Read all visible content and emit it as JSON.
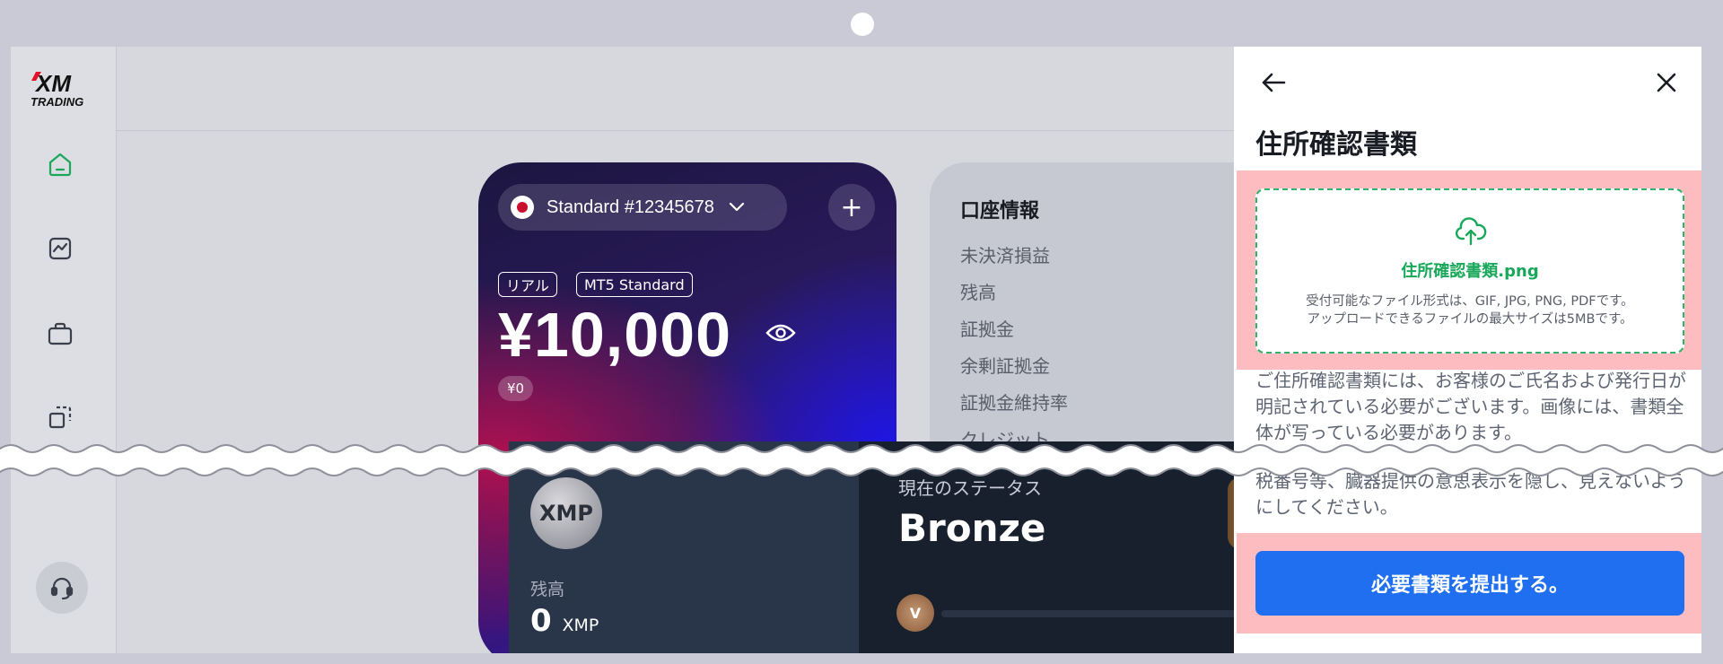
{
  "logo": {
    "brand": "XM",
    "sub": "TRADING"
  },
  "nav": {
    "items": [
      {
        "name": "home",
        "icon": "home-icon",
        "active": true
      },
      {
        "name": "chart",
        "icon": "chart-icon"
      },
      {
        "name": "portfolio",
        "icon": "briefcase-icon"
      },
      {
        "name": "copy",
        "icon": "copy-icon"
      }
    ],
    "support_icon": "headset-icon"
  },
  "account": {
    "selector": "Standard #12345678",
    "tags": [
      "リアル",
      "MT5 Standard"
    ],
    "balance": "¥10,000",
    "sub_balance": "¥0"
  },
  "info": {
    "title": "口座情報",
    "rows": [
      "未決済損益",
      "残高",
      "証拠金",
      "余剰証拠金",
      "証拠金維持率",
      "クレジット"
    ]
  },
  "xmp": {
    "coin_label": "XMP",
    "label": "残高",
    "value": "0",
    "unit": "XMP"
  },
  "status": {
    "label": "現在のステータス",
    "value": "Bronze",
    "badge": "V"
  },
  "modal": {
    "title": "住所確認書類",
    "file_name": "住所確認書類.png",
    "file_note_1": "受付可能なファイル形式は、GIF, JPG, PNG, PDFです。",
    "file_note_2": "アップロードできるファイルの最大サイズは5MBです。",
    "desc_1": "ご住所確認書類には、お客様のご氏名および発行日が明記されている必要がございます。画像には、書類全体が写っている必要があります。",
    "desc_2": "税番号等、臓器提供の意思表示を隠し、見えないようにしてください。",
    "submit": "必要書類を提出する。"
  },
  "colors": {
    "accent": "#1f6ff0",
    "success": "#19a85a",
    "highlight": "#fdbcc0",
    "nav_active": "#19a85a"
  }
}
